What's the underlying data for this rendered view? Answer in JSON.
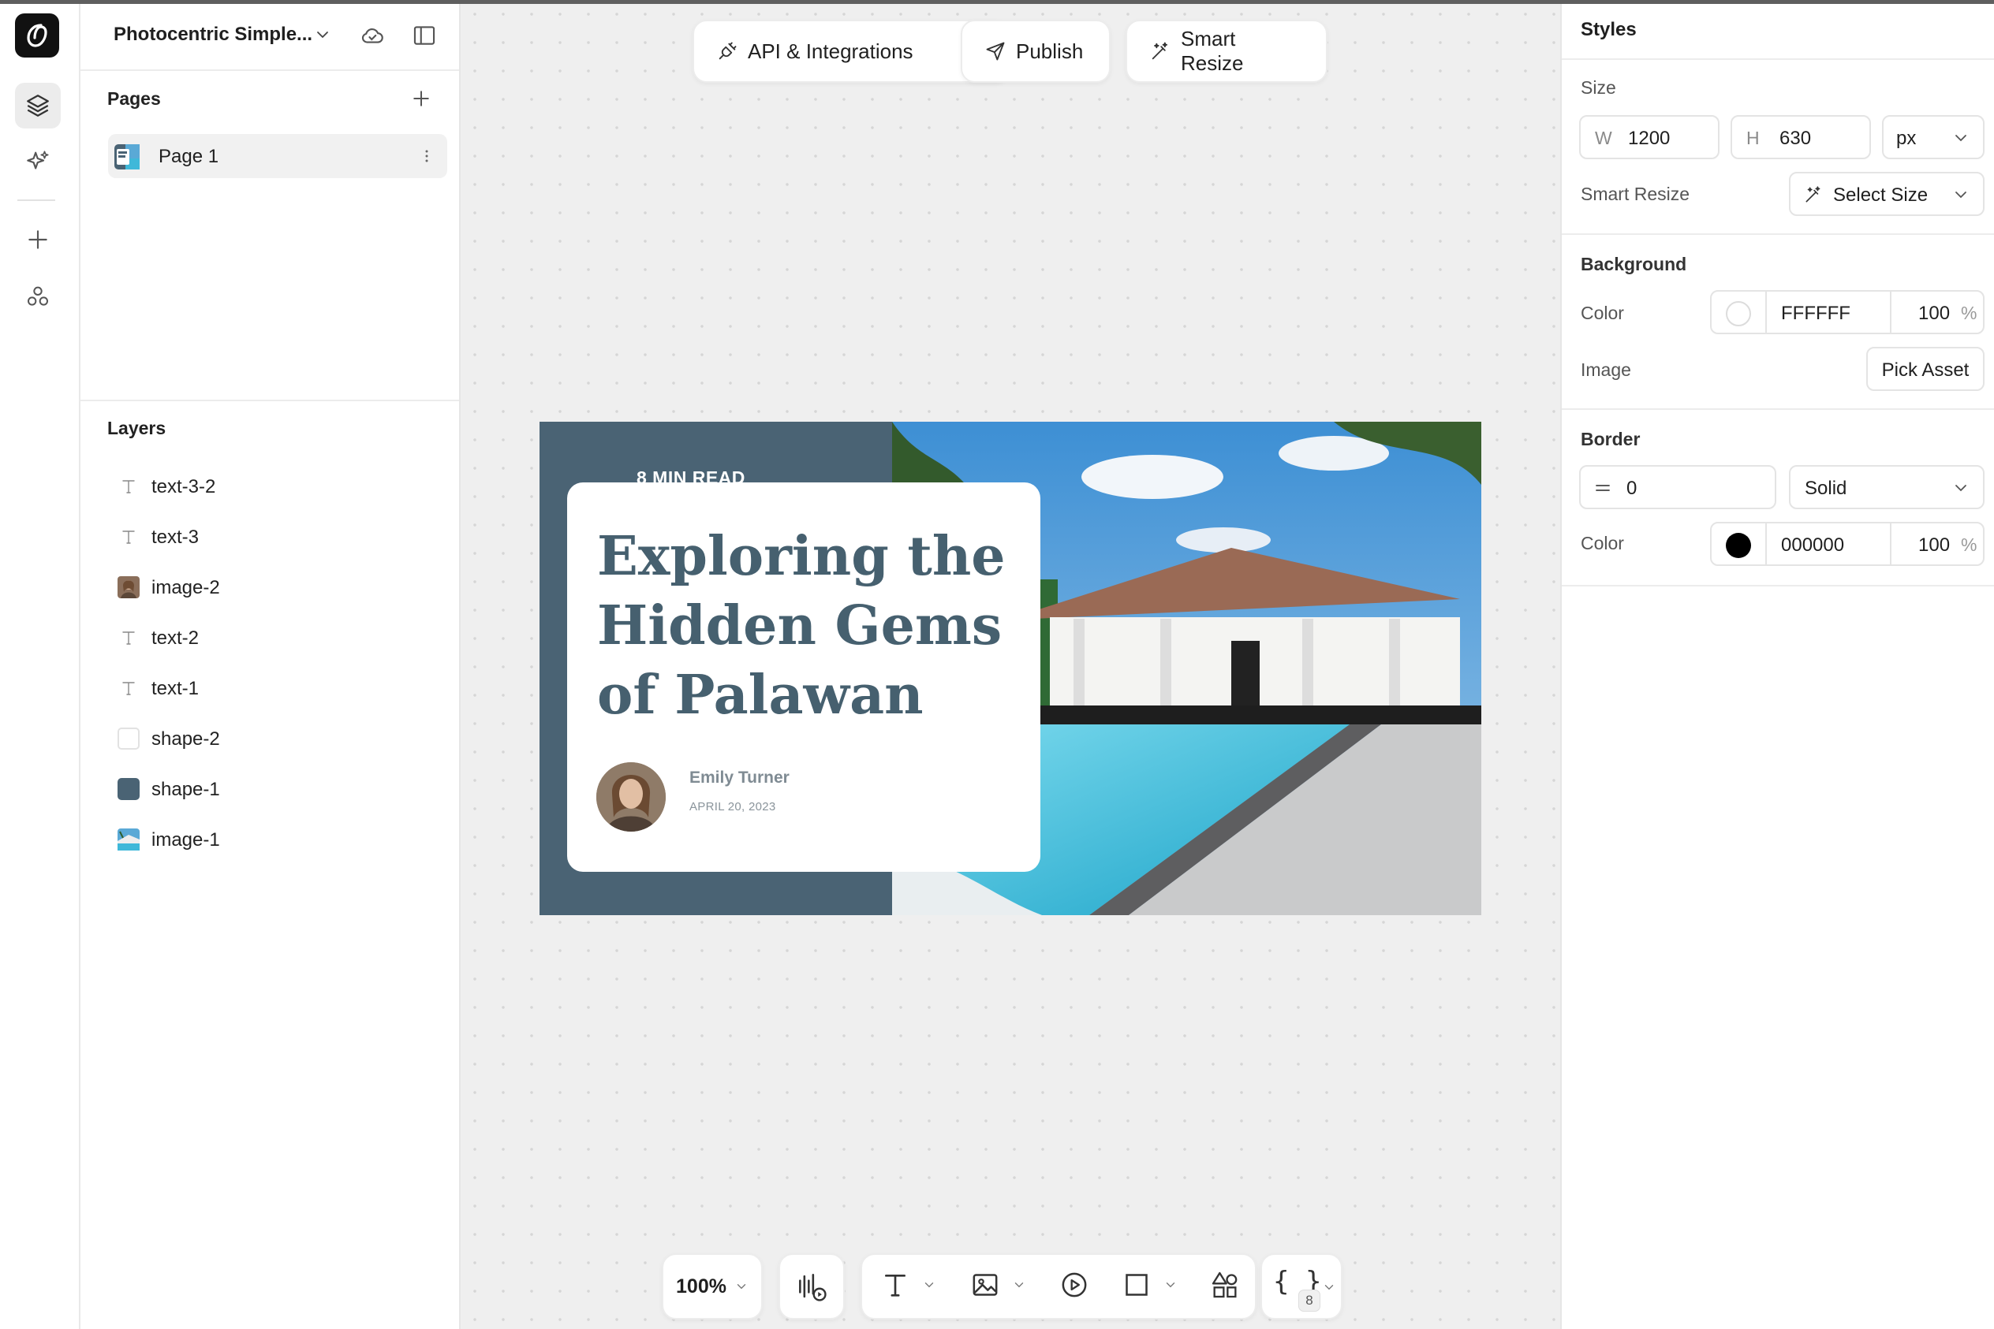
{
  "project": {
    "name": "Photocentric Simple..."
  },
  "pages": {
    "title": "Pages",
    "items": [
      {
        "label": "Page 1"
      }
    ]
  },
  "layers": {
    "title": "Layers",
    "items": [
      {
        "label": "text-3-2",
        "kind": "text"
      },
      {
        "label": "text-3",
        "kind": "text"
      },
      {
        "label": "image-2",
        "kind": "image"
      },
      {
        "label": "text-2",
        "kind": "text"
      },
      {
        "label": "text-1",
        "kind": "text"
      },
      {
        "label": "shape-2",
        "kind": "shape",
        "color": "#ffffff"
      },
      {
        "label": "shape-1",
        "kind": "shape",
        "color": "#4a6374"
      },
      {
        "label": "image-1",
        "kind": "image"
      }
    ]
  },
  "toolbar_top": {
    "api_label": "API & Integrations",
    "publish_label": "Publish",
    "smart_resize_label": "Smart Resize"
  },
  "artboard": {
    "background_color": "#4a6374",
    "kicker": "8 MIN READ",
    "headline": "Exploring the Hidden Gems of Palawan",
    "author_name": "Emily Turner",
    "author_date": "APRIL 20, 2023"
  },
  "toolbar_bottom": {
    "zoom": "100%",
    "variables_count": "8"
  },
  "styles": {
    "title": "Styles",
    "size": {
      "label": "Size",
      "w_prefix": "W",
      "w": "1200",
      "h_prefix": "H",
      "h": "630",
      "unit": "px"
    },
    "smart_resize": {
      "label": "Smart Resize",
      "button": "Select Size"
    },
    "background": {
      "label": "Background",
      "color_label": "Color",
      "color_hex": "FFFFFF",
      "opacity": "100",
      "image_label": "Image",
      "pick_asset": "Pick Asset"
    },
    "border": {
      "label": "Border",
      "width": "0",
      "style": "Solid",
      "color_label": "Color",
      "color_hex": "000000",
      "opacity": "100"
    },
    "percent_sign": "%"
  }
}
